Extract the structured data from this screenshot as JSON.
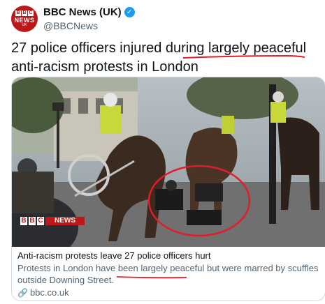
{
  "account": {
    "avatar_letters": [
      "B",
      "B",
      "C"
    ],
    "avatar_news": "NEWS",
    "avatar_region": "UK",
    "name": "BBC News (UK)",
    "handle": "@BBCNews",
    "verified_icon": "verified-badge-icon"
  },
  "tweet": {
    "text": "27 police officers injured during largely peaceful anti-racism protests in London"
  },
  "card": {
    "logo_letters": [
      "B",
      "B",
      "C"
    ],
    "logo_word": "NEWS",
    "title": "Anti-racism protests leave 27 police officers hurt",
    "description": "Protests in London have been largely peaceful but were marred by scuffles outside Downing Street.",
    "domain": "bbc.co.uk",
    "domain_icon": "link-icon"
  },
  "colors": {
    "bbc_red": "#bb1919",
    "annotation_red": "#e11d2a",
    "verified_blue": "#1d9bf0"
  }
}
